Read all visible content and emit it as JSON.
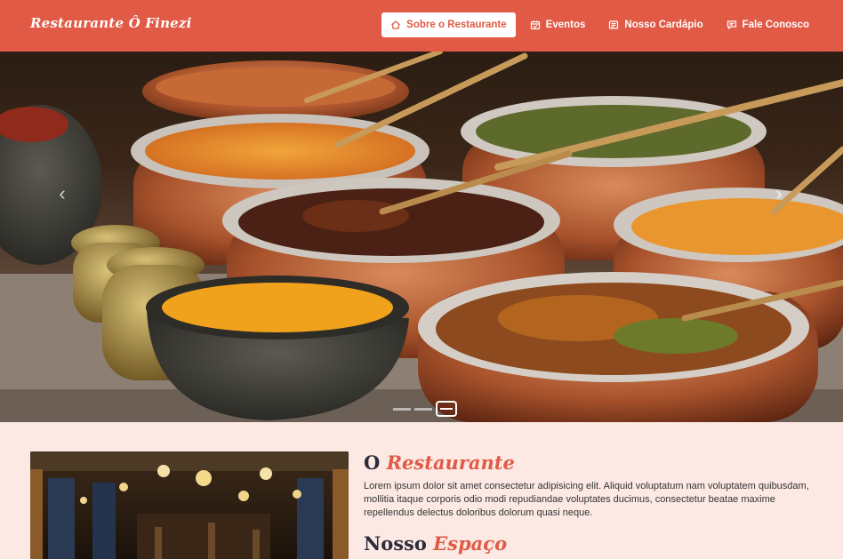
{
  "brand": "Restaurante Ô Finezi",
  "nav": [
    {
      "label": "Sobre o Restaurante",
      "icon": "home-icon",
      "active": true
    },
    {
      "label": "Eventos",
      "icon": "calendar-icon"
    },
    {
      "label": "Nosso Cardápio",
      "icon": "menu-card-icon"
    },
    {
      "label": "Fale Conosco",
      "icon": "chat-icon"
    }
  ],
  "carousel": {
    "prev": "‹",
    "next": "›",
    "slides_count": 3,
    "active_index": 2
  },
  "about": {
    "title_part1": "O",
    "title_part2": "Restaurante",
    "text": "Lorem ipsum dolor sit amet consectetur adipisicing elit. Aliquid voluptatum nam voluptatem quibusdam, mollitia itaque corporis odio modi repudiandae voluptates ducimus, consectetur beatae maxime repellendus delectus doloribus dolorum quasi neque.",
    "space_part1": "Nosso",
    "space_part2": "Espaço"
  },
  "colors": {
    "accent": "#e05a45",
    "background": "#fde9e4",
    "heading_dark": "#2b2b3a"
  }
}
